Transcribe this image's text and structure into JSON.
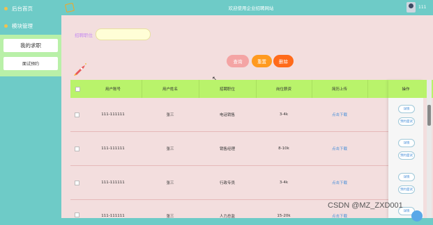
{
  "sidebar": {
    "items": [
      {
        "label": "后台首页"
      },
      {
        "label": "模块管理"
      }
    ],
    "submenu": [
      {
        "label": "我的求职"
      },
      {
        "label": "面试预约"
      }
    ]
  },
  "header": {
    "title": "欢迎使用企业招聘网站",
    "username": "111"
  },
  "search": {
    "label": "招聘职位",
    "value": "",
    "placeholder": ""
  },
  "buttons": {
    "query": "查询",
    "reset": "重置",
    "delete": "删除"
  },
  "table": {
    "headers": [
      "用户账号",
      "用户姓名",
      "招聘职位",
      "岗位薪资",
      "简历上传"
    ],
    "op_header": "操作",
    "rows": [
      {
        "account": "111-111111",
        "name": "张三",
        "position": "电话销售",
        "salary": "3-4k",
        "resume": "点击下载"
      },
      {
        "account": "111-111111",
        "name": "张三",
        "position": "销售经理",
        "salary": "8-10k",
        "resume": "点击下载"
      },
      {
        "account": "111-111111",
        "name": "张三",
        "position": "行政专员",
        "salary": "3-4k",
        "resume": "点击下载"
      },
      {
        "account": "111-111111",
        "name": "张三",
        "position": "人力总监",
        "salary": "15-20k",
        "resume": "点击下载"
      }
    ],
    "op_buttons": {
      "detail": "详情",
      "interview": "预约面试"
    }
  },
  "watermark": "CSDN @MZ_ZXD001",
  "colors": {
    "sidebar_bg": "#6ecbc7",
    "main_bg": "#f3dede",
    "table_header": "#b9f36b",
    "query_btn": "#f4a4a4",
    "reset_btn": "#ff9a1f",
    "delete_btn": "#ff6a1a"
  },
  "icons": [
    "logo-icon",
    "rocket-icon",
    "avatar-icon",
    "cursor-icon"
  ]
}
